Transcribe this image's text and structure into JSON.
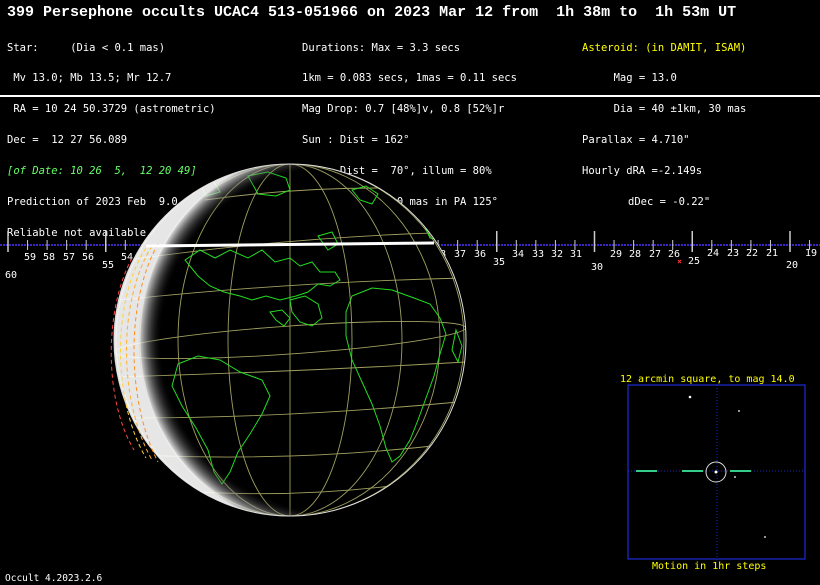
{
  "header": {
    "title": "399 Persephone occults UCAC4 513-051966 on 2023 Mar 12 from  1h 38m to  1h 53m UT"
  },
  "star_info": {
    "line1": "Star:     (Dia < 0.1 mas)",
    "line2": " Mv 13.0; Mb 13.5; Mr 12.7",
    "line3": " RA = 10 24 50.3729 (astrometric)",
    "line4": "Dec =  12 27 56.089",
    "line5": "[of Date: 10 26  5,  12 20 49]",
    "line6": "Prediction of 2023 Feb  9.0",
    "line7": "Reliable not available"
  },
  "event_info": {
    "line1": "Durations: Max = 3.3 secs",
    "line2": "1km = 0.083 secs, 1mas = 0.11 secs",
    "line3": "Mag Drop: 0.7 [48%]v, 0.8 [52%]r",
    "line4": "Sun : Dist = 162°",
    "line5": "Moon: Dist =  70°, illum = 80%",
    "line6": "Error 35.0 x 1.0 mas in PA 125°"
  },
  "asteroid_info": {
    "line1": "Asteroid: (in DAMIT, ISAM)",
    "line2": "     Mag = 13.0",
    "line3": "     Dia = 40 ±1km, 30 mas",
    "line4": "Parallax = 4.710\"",
    "line5": "Hourly dRA =-2.149s",
    "line6": "dDec = -0.22\""
  },
  "timeline": {
    "minor_labels": [
      "59",
      "58",
      "57",
      "56",
      "54",
      "38",
      "37",
      "36",
      "34",
      "33",
      "32",
      "31",
      "29",
      "28",
      "27",
      "26",
      "24",
      "23",
      "22",
      "21",
      "19"
    ],
    "major_labels": [
      "60",
      "55",
      "35",
      "30",
      "25",
      "20"
    ]
  },
  "star_chart": {
    "title": "12 arcmin square, to mag 14.0",
    "footer": "Motion in 1hr steps"
  },
  "footer": {
    "version": "Occult 4.2023.2.6"
  },
  "colors": {
    "coast": "#22dd22",
    "grid": "#a0a060",
    "path_limit": "#ffd040",
    "timeline": "#5533ff",
    "chart_frame": "#2233ff"
  }
}
